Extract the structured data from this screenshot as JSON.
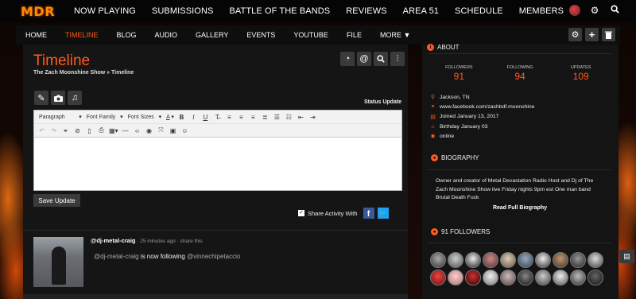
{
  "site": {
    "logo": "MDR",
    "topnav": [
      "NOW PLAYING",
      "SUBMISSIONS",
      "BATTLE OF THE BANDS",
      "REVIEWS",
      "AREA 51",
      "SCHEDULE",
      "MEMBERS"
    ]
  },
  "subnav": {
    "items": [
      "HOME",
      "TIMELINE",
      "BLOG",
      "AUDIO",
      "GALLERY",
      "EVENTS",
      "YOUTUBE",
      "FILE",
      "MORE ▼"
    ],
    "active": "TIMELINE"
  },
  "page": {
    "title": "Timeline",
    "breadcrumb": "The Zach Moonshine Show » Timeline"
  },
  "composer": {
    "status_label": "Status Update",
    "paragraph": "Paragraph",
    "font_family": "Font Family",
    "font_size": "Font Sizes",
    "font_color": "A",
    "save_label": "Save Update",
    "share_label": "Share Activity With",
    "share_checked": true
  },
  "feed": [
    {
      "user": "@dj-metal-craig",
      "meta": " · 25 minutes ago · share this",
      "actor": "@dj-metal-craig",
      "verb": " is now following ",
      "target": "@vinnechipetaccio"
    }
  ],
  "sidebar": {
    "about_title": "ABOUT",
    "stats": [
      {
        "label": "FOLLOWERS",
        "value": "91"
      },
      {
        "label": "FOLLOWING",
        "value": "94"
      },
      {
        "label": "UPDATES",
        "value": "109"
      }
    ],
    "info": [
      {
        "icon": "location-icon",
        "text": "Jackson, TN"
      },
      {
        "icon": "link-icon",
        "text": "www.facebook.com/zachbdf.moonshine"
      },
      {
        "icon": "calendar-icon",
        "text": "Joined January 13, 2017"
      },
      {
        "icon": "cake-icon",
        "text": "Birthday January 03"
      },
      {
        "icon": "online-icon",
        "text": "online"
      }
    ],
    "bio_title": "BIOGRAPHY",
    "bio": "Owner and creator of Metal Devastation Radio Host and Dj of The Zach Moonshine Show live Friday nights 9pm est One man band Brutal Death Fuck",
    "bio_link": "Read Full Biography",
    "followers_title": "91 FOLLOWERS"
  },
  "colors": {
    "accent": "#ff5a1f",
    "logo": "#ff8a00",
    "facebook": "#3b5998",
    "twitter": "#1da1f2"
  }
}
